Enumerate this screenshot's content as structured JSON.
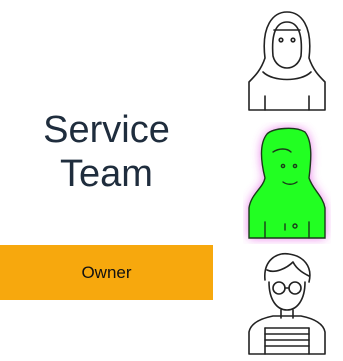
{
  "title": {
    "line1": "Service",
    "line2": "Team"
  },
  "badge": {
    "label": "Owner",
    "color": "#f7a80d"
  },
  "avatars": [
    {
      "icon": "person-hijab-icon",
      "highlighted": false
    },
    {
      "icon": "person-highlighted-icon",
      "highlighted": true,
      "fill": "#22ff22",
      "glow": "#e040e0"
    },
    {
      "icon": "person-glasses-icon",
      "highlighted": false
    }
  ]
}
